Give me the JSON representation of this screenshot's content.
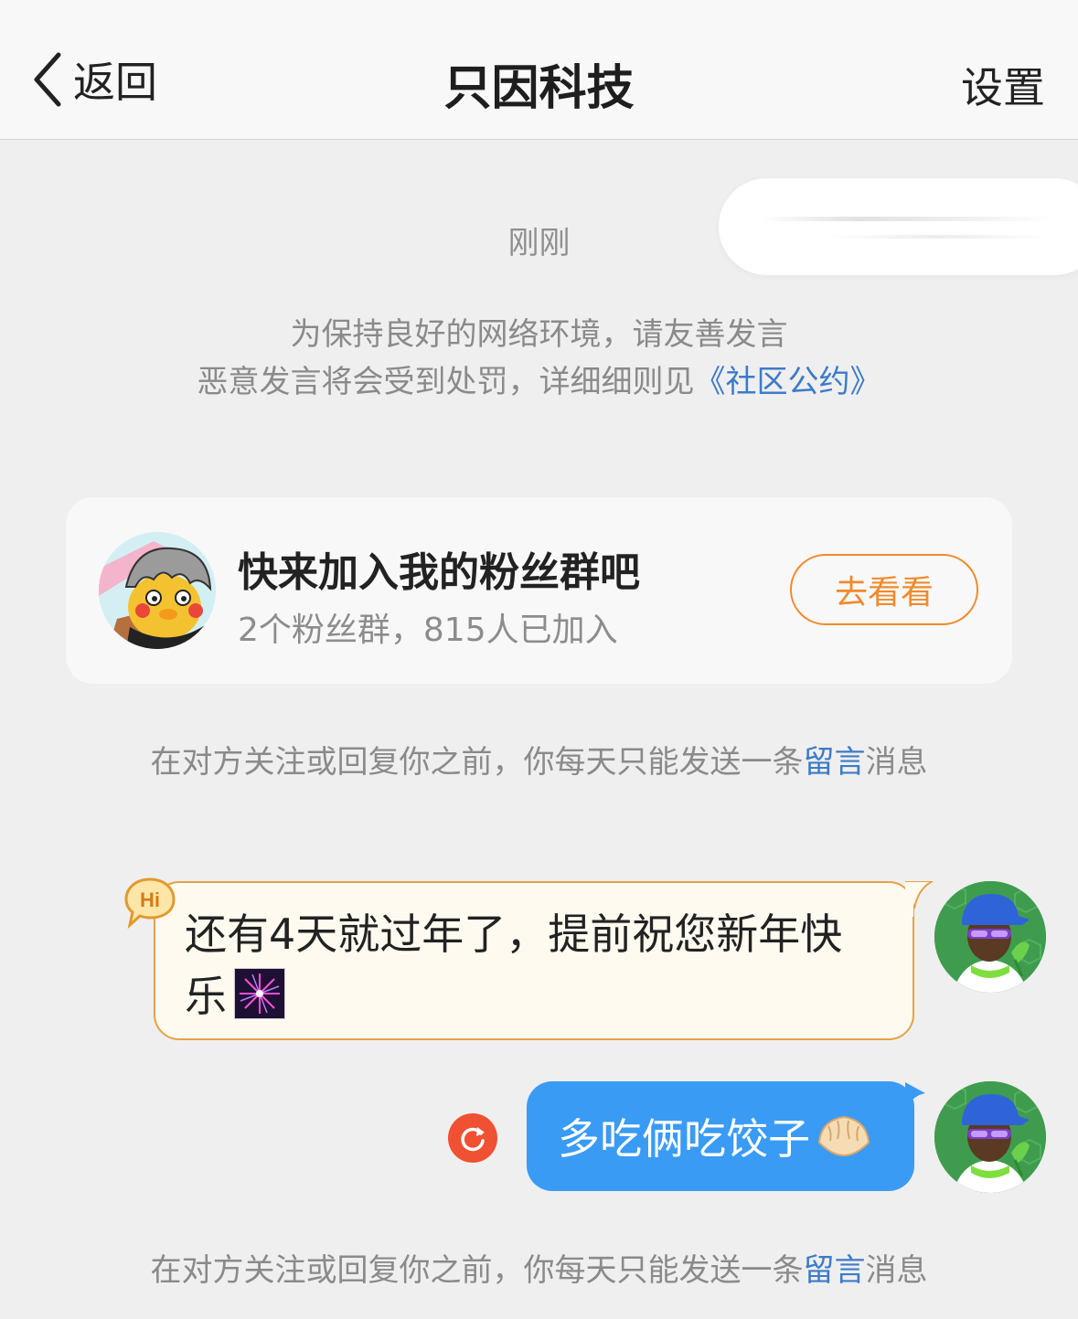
{
  "header": {
    "back_label": "返回",
    "title": "只因科技",
    "settings_label": "设置"
  },
  "timestamp": "刚刚",
  "notice": {
    "line1": "为保持良好的网络环境，请友善发言",
    "line2_prefix": "恶意发言将会受到处罚，详细细则见",
    "line2_link": "《社区公约》"
  },
  "fan_group": {
    "title": "快来加入我的粉丝群吧",
    "subtitle": "2个粉丝群，815人已加入",
    "button_label": "去看看"
  },
  "limit_notice": {
    "prefix": "在对方关注或回复你之前，你每天只能发送一条",
    "link": "留言",
    "suffix": "消息"
  },
  "messages": [
    {
      "text": "还有4天就过年了，提前祝您新年快乐",
      "badge": "Hi",
      "emoji_icon": "fireworks-icon"
    },
    {
      "text": "多吃俩吃饺子",
      "emoji_icon": "dumpling-icon",
      "status_icon": "retry-icon"
    }
  ],
  "colors": {
    "accent_orange": "#f08a2c",
    "link_blue": "#3d7bc8",
    "bubble_blue": "#3a9bf4",
    "retry_red": "#ef5132",
    "background": "#efefef"
  }
}
